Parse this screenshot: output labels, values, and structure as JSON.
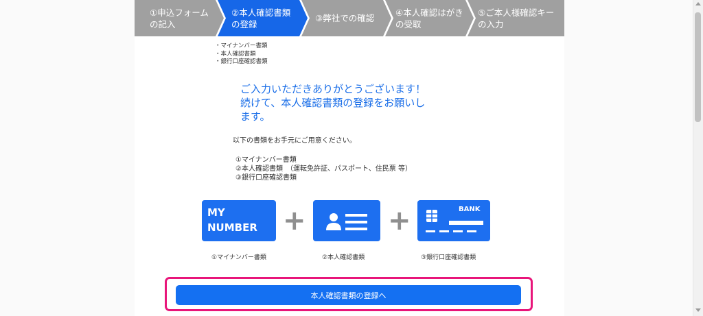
{
  "steps": [
    {
      "label": "①申込フォーム\nの記入",
      "active": false
    },
    {
      "label": "②本人確認書類\nの登録",
      "active": true
    },
    {
      "label": "③弊社での確認",
      "active": false
    },
    {
      "label": "④本人確認はがき\nの受取",
      "active": false
    },
    {
      "label": "⑤ご本人様確認キー\nの入力",
      "active": false
    }
  ],
  "sidebar_docs": [
    "・マイナンバー書類",
    "・本人確認書類",
    "・銀行口座確認書類"
  ],
  "heading": "ご入力いただきありがとうございます！\n続けて、本人確認書類の登録をお願いし\nます。",
  "intro": "以下の書類をお手元にご用意ください。",
  "doc_list": [
    "①マイナンバー書類",
    "②本人確認書類　（運転免許証、パスポート、住民票 等）",
    "③銀行口座確認書類"
  ],
  "cards": {
    "my_number_line1": "MY",
    "my_number_line2": "NUMBER",
    "bank_text": "BANK",
    "plus": "+"
  },
  "card_labels": [
    "①マイナンバー書類",
    "②本人確認書類",
    "③銀行口座確認書類"
  ],
  "primary_button": "本人確認書類の登録へ",
  "colors": {
    "accent": "#1470f2",
    "step_inactive": "#a0a0a0",
    "step_active": "#1667e8",
    "highlight": "#e8157a",
    "heading": "#1a6ee8"
  }
}
